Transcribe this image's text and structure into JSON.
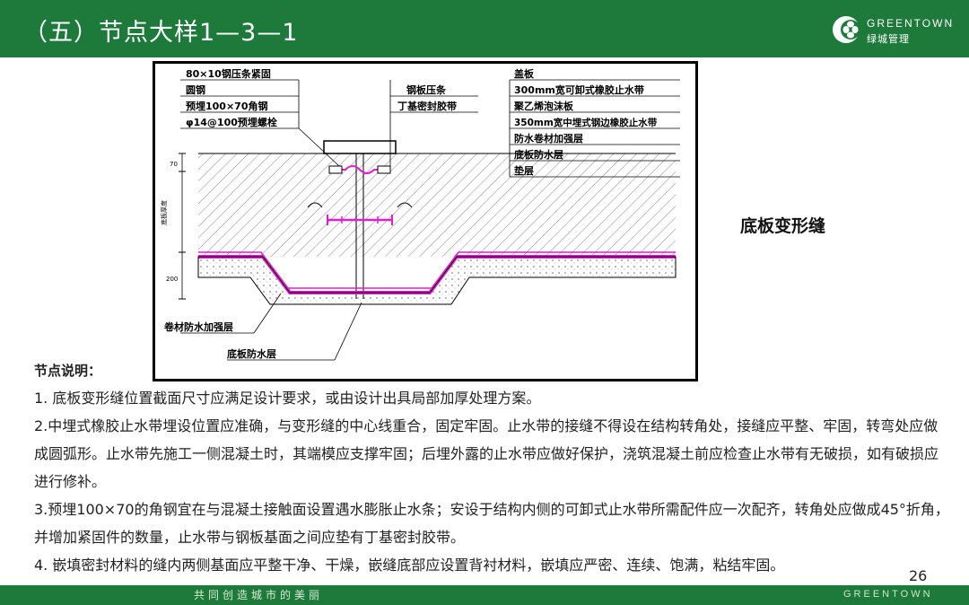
{
  "header": {
    "title": "（五）节点大样1—3—1"
  },
  "logo": {
    "brand": "GREENTOWN",
    "sub": "绿城管理"
  },
  "drawing": {
    "left_labels": [
      "80×10钢压条紧固",
      "圆钢",
      "预埋100×70角钢",
      "φ14@100预埋螺栓"
    ],
    "mid_labels": [
      "钢板压条",
      "丁基密封胶带"
    ],
    "right_labels": [
      "盖板",
      "300mm宽可卸式橡胶止水带",
      "聚乙烯泡沫板",
      "350mm宽中埋式钢边橡胶止水带",
      "防水卷材加强层",
      "底板防水层",
      "垫层"
    ],
    "bottom_labels": [
      "卷材防水加强层",
      "底板防水层"
    ],
    "dims": [
      "70",
      "底板厚度",
      "200"
    ]
  },
  "caption": "底板变形缝",
  "notes": {
    "heading": "节点说明：",
    "items": [
      "1. 底板变形缝位置截面尺寸应满足设计要求，或由设计出具局部加厚处理方案。",
      "2.中埋式橡胶止水带埋设位置应准确，与变形缝的中心线重合，固定牢固。止水带的接缝不得设在结构转角处，接缝应平整、牢固，转弯处应做成圆弧形。止水带先施工一侧混凝土时，其端模应支撑牢固；后埋外露的止水带应做好保护，浇筑混凝土前应检查止水带有无破损，如有破损应进行修补。",
      "3.预埋100×70的角钢宜在与混凝土接触面设置遇水膨胀止水条；安设于结构内侧的可卸式止水带所需配件应一次配齐，转角处应做成45°折角，并增加紧固件的数量，止水带与钢板基面之间应垫有丁基密封胶带。",
      "4. 嵌填密封材料的缝内两侧基面应平整干净、干燥，嵌缝底部应设置背衬材料，嵌填应严密、连续、饱满，粘结牢固。"
    ]
  },
  "page_number": "26",
  "footer": {
    "slogan": "共同创造城市的美丽",
    "brand": "GREENTOWN"
  },
  "colors": {
    "brand_green": "#1e7a3b",
    "membrane": "#e020d0"
  }
}
